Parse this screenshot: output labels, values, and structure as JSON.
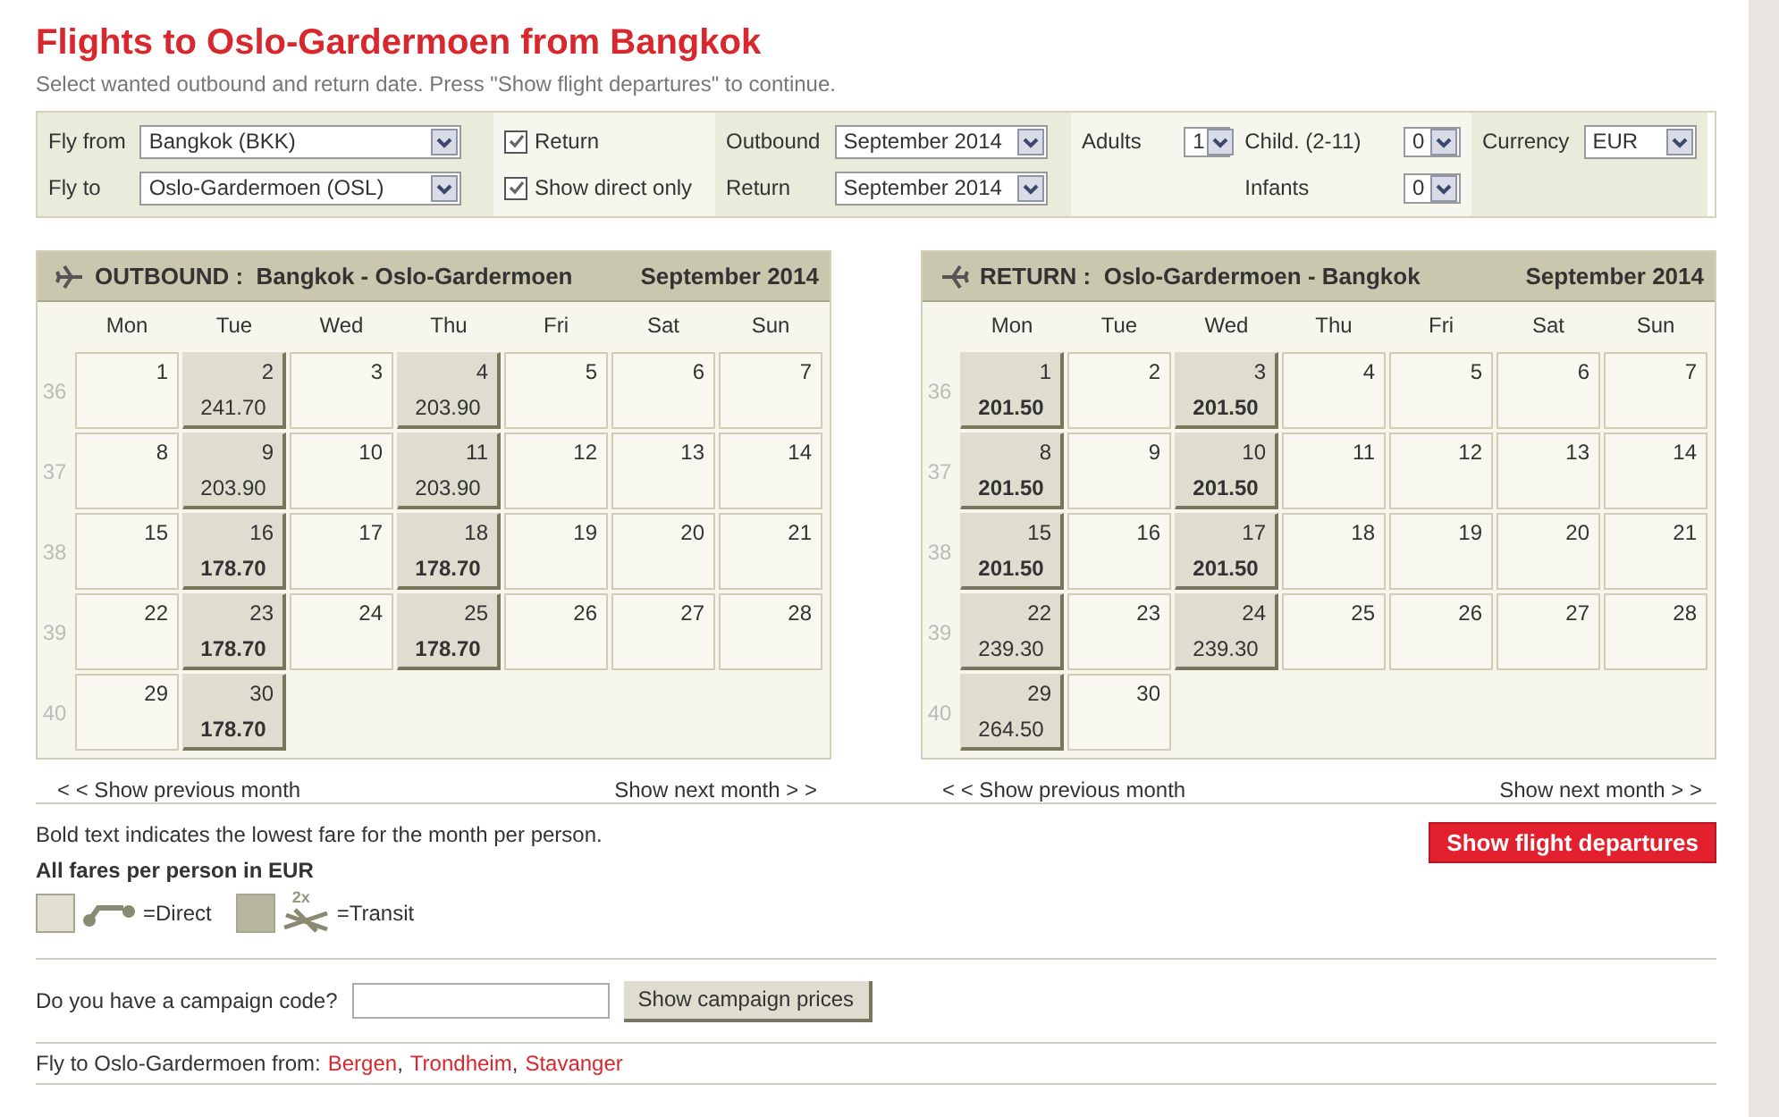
{
  "title": "Flights to Oslo-Gardermoen from Bangkok",
  "subtitle": "Select wanted outbound and return date. Press \"Show flight departures\" to continue.",
  "filters": {
    "fly_from": {
      "label": "Fly from",
      "value": "Bangkok (BKK)"
    },
    "fly_to": {
      "label": "Fly to",
      "value": "Oslo-Gardermoen (OSL)"
    },
    "return_trip": {
      "label": "Return",
      "checked": true
    },
    "direct_only": {
      "label": "Show direct only",
      "checked": true
    },
    "outbound": {
      "label": "Outbound",
      "value": "September 2014"
    },
    "return_month": {
      "label": "Return",
      "value": "September 2014"
    },
    "adults": {
      "label": "Adults",
      "value": "1"
    },
    "children": {
      "label": "Child. (2-11)",
      "value": "0"
    },
    "infants": {
      "label": "Infants",
      "value": "0"
    },
    "currency": {
      "label": "Currency",
      "value": "EUR"
    }
  },
  "calendars": [
    {
      "kind": "outbound",
      "direction": "OUTBOUND :",
      "route": "Bangkok - Oslo-Gardermoen",
      "month": "September 2014",
      "weekdays": [
        "Mon",
        "Tue",
        "Wed",
        "Thu",
        "Fri",
        "Sat",
        "Sun"
      ],
      "weeks": [
        {
          "number": "36",
          "days": [
            {
              "day": "1"
            },
            {
              "day": "2",
              "fare": "241.70",
              "lowest": false
            },
            {
              "day": "3"
            },
            {
              "day": "4",
              "fare": "203.90",
              "lowest": false
            },
            {
              "day": "5"
            },
            {
              "day": "6"
            },
            {
              "day": "7"
            }
          ]
        },
        {
          "number": "37",
          "days": [
            {
              "day": "8"
            },
            {
              "day": "9",
              "fare": "203.90",
              "lowest": false
            },
            {
              "day": "10"
            },
            {
              "day": "11",
              "fare": "203.90",
              "lowest": false
            },
            {
              "day": "12"
            },
            {
              "day": "13"
            },
            {
              "day": "14"
            }
          ]
        },
        {
          "number": "38",
          "days": [
            {
              "day": "15"
            },
            {
              "day": "16",
              "fare": "178.70",
              "lowest": true
            },
            {
              "day": "17"
            },
            {
              "day": "18",
              "fare": "178.70",
              "lowest": true
            },
            {
              "day": "19"
            },
            {
              "day": "20"
            },
            {
              "day": "21"
            }
          ]
        },
        {
          "number": "39",
          "days": [
            {
              "day": "22"
            },
            {
              "day": "23",
              "fare": "178.70",
              "lowest": true
            },
            {
              "day": "24"
            },
            {
              "day": "25",
              "fare": "178.70",
              "lowest": true
            },
            {
              "day": "26"
            },
            {
              "day": "27"
            },
            {
              "day": "28"
            }
          ]
        },
        {
          "number": "40",
          "days": [
            {
              "day": "29"
            },
            {
              "day": "30",
              "fare": "178.70",
              "lowest": true
            }
          ]
        }
      ],
      "prev_link": "< < Show previous month",
      "next_link": "Show next month > >"
    },
    {
      "kind": "return",
      "direction": "RETURN :",
      "route": "Oslo-Gardermoen - Bangkok",
      "month": "September 2014",
      "weekdays": [
        "Mon",
        "Tue",
        "Wed",
        "Thu",
        "Fri",
        "Sat",
        "Sun"
      ],
      "weeks": [
        {
          "number": "36",
          "days": [
            {
              "day": "1",
              "fare": "201.50",
              "lowest": true
            },
            {
              "day": "2"
            },
            {
              "day": "3",
              "fare": "201.50",
              "lowest": true
            },
            {
              "day": "4"
            },
            {
              "day": "5"
            },
            {
              "day": "6"
            },
            {
              "day": "7"
            }
          ]
        },
        {
          "number": "37",
          "days": [
            {
              "day": "8",
              "fare": "201.50",
              "lowest": true
            },
            {
              "day": "9"
            },
            {
              "day": "10",
              "fare": "201.50",
              "lowest": true
            },
            {
              "day": "11"
            },
            {
              "day": "12"
            },
            {
              "day": "13"
            },
            {
              "day": "14"
            }
          ]
        },
        {
          "number": "38",
          "days": [
            {
              "day": "15",
              "fare": "201.50",
              "lowest": true
            },
            {
              "day": "16"
            },
            {
              "day": "17",
              "fare": "201.50",
              "lowest": true
            },
            {
              "day": "18"
            },
            {
              "day": "19"
            },
            {
              "day": "20"
            },
            {
              "day": "21"
            }
          ]
        },
        {
          "number": "39",
          "days": [
            {
              "day": "22",
              "fare": "239.30",
              "lowest": false
            },
            {
              "day": "23"
            },
            {
              "day": "24",
              "fare": "239.30",
              "lowest": false
            },
            {
              "day": "25"
            },
            {
              "day": "26"
            },
            {
              "day": "27"
            },
            {
              "day": "28"
            }
          ]
        },
        {
          "number": "40",
          "days": [
            {
              "day": "29",
              "fare": "264.50",
              "lowest": false
            },
            {
              "day": "30"
            }
          ]
        }
      ],
      "prev_link": "< < Show previous month",
      "next_link": "Show next month > >"
    }
  ],
  "legend": {
    "note": "Bold text indicates the lowest fare for the month per person.",
    "currency_note": "All fares per person in EUR",
    "items": [
      {
        "kind": "direct",
        "label": "=Direct"
      },
      {
        "kind": "transit",
        "label": "=Transit",
        "badge": "2x"
      }
    ]
  },
  "show_button": "Show flight departures",
  "campaign": {
    "label": "Do you have a campaign code?",
    "button": "Show campaign prices"
  },
  "other_origins": {
    "label": "Fly to Oslo-Gardermoen from:",
    "separator": ",",
    "links": [
      "Bergen",
      "Trondheim",
      "Stavanger"
    ]
  }
}
